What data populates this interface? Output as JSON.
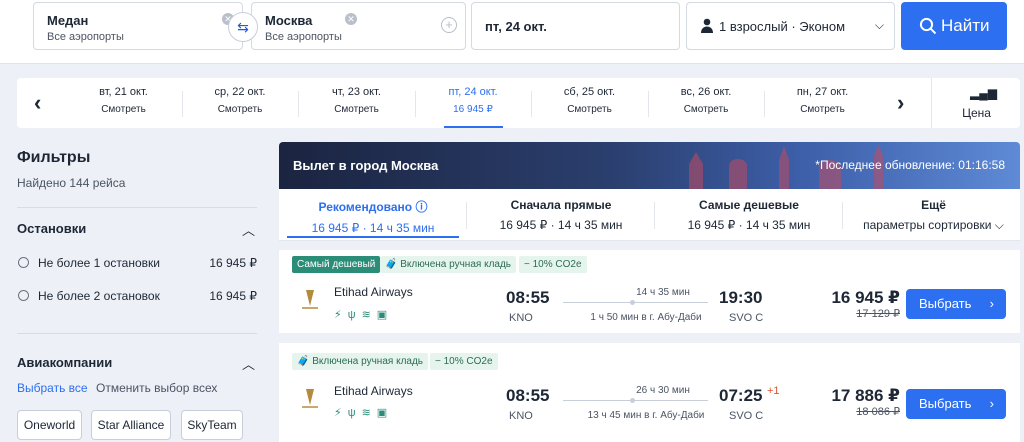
{
  "search": {
    "from": {
      "city": "Медан",
      "airports": "Все аэропорты"
    },
    "to": {
      "city": "Москва",
      "airports": "Все аэропорты"
    },
    "date": "пт, 24 окт.",
    "passengers": "1 взрослый · Эконом",
    "find_label": "Найти"
  },
  "dates": [
    {
      "day": "вт, 21 окт.",
      "price": "Смотреть"
    },
    {
      "day": "ср, 22 окт.",
      "price": "Смотреть"
    },
    {
      "day": "чт, 23 окт.",
      "price": "Смотреть"
    },
    {
      "day": "пт, 24 окт.",
      "price": "16 945 ₽",
      "selected": true
    },
    {
      "day": "сб, 25 окт.",
      "price": "Смотреть"
    },
    {
      "day": "вс, 26 окт.",
      "price": "Смотреть"
    },
    {
      "day": "пн, 27 окт.",
      "price": "Смотреть"
    }
  ],
  "price_tab": "Цена",
  "filters": {
    "title": "Фильтры",
    "found": "Найдено 144 рейса",
    "stops": {
      "title": "Остановки",
      "options": [
        {
          "label": "Не более 1 остановки",
          "price": "16 945 ₽"
        },
        {
          "label": "Не более 2 остановок",
          "price": "16 945 ₽"
        }
      ]
    },
    "airlines": {
      "title": "Авиакомпании",
      "select_all": "Выбрать все",
      "deselect_all": "Отменить выбор всех",
      "alliances": [
        "Oneworld",
        "Star Alliance",
        "SkyTeam"
      ]
    }
  },
  "results": {
    "banner_title": "Вылет в город Москва",
    "updated": "*Последнее обновление: 01:16:58",
    "sorts": [
      {
        "title": "Рекомендовано",
        "info": "ⓘ",
        "sub": "16 945 ₽ · 14 ч 35 мин",
        "selected": true
      },
      {
        "title": "Сначала прямые",
        "sub": "16 945 ₽ · 14 ч 35 мин"
      },
      {
        "title": "Самые дешевые",
        "sub": "16 945 ₽ · 14 ч 35 мин"
      },
      {
        "title": "Ещё",
        "sub": "параметры сортировки"
      }
    ],
    "flights": [
      {
        "tags": [
          "Самый дешевый",
          "Включена ручная кладь",
          "− 10% CO2e"
        ],
        "airline": "Etihad Airways",
        "dep_time": "08:55",
        "dep_code": "KNO",
        "duration": "14 ч 35 мин",
        "layover": "1 ч 50 мин в г. Абу-Даби",
        "arr_time": "19:30",
        "arr_day": "",
        "arr_code": "SVO C",
        "price": "16 945 ₽",
        "old_price": "17 129 ₽",
        "select": "Выбрать"
      },
      {
        "tags": [
          "Включена ручная кладь",
          "− 10% CO2e"
        ],
        "airline": "Etihad Airways",
        "dep_time": "08:55",
        "dep_code": "KNO",
        "duration": "26 ч 30 мин",
        "layover": "13 ч 45 мин в г. Абу-Даби",
        "arr_time": "07:25",
        "arr_day": "+1",
        "arr_code": "SVO C",
        "price": "17 886 ₽",
        "old_price": "18 086 ₽",
        "select": "Выбрать"
      }
    ]
  }
}
